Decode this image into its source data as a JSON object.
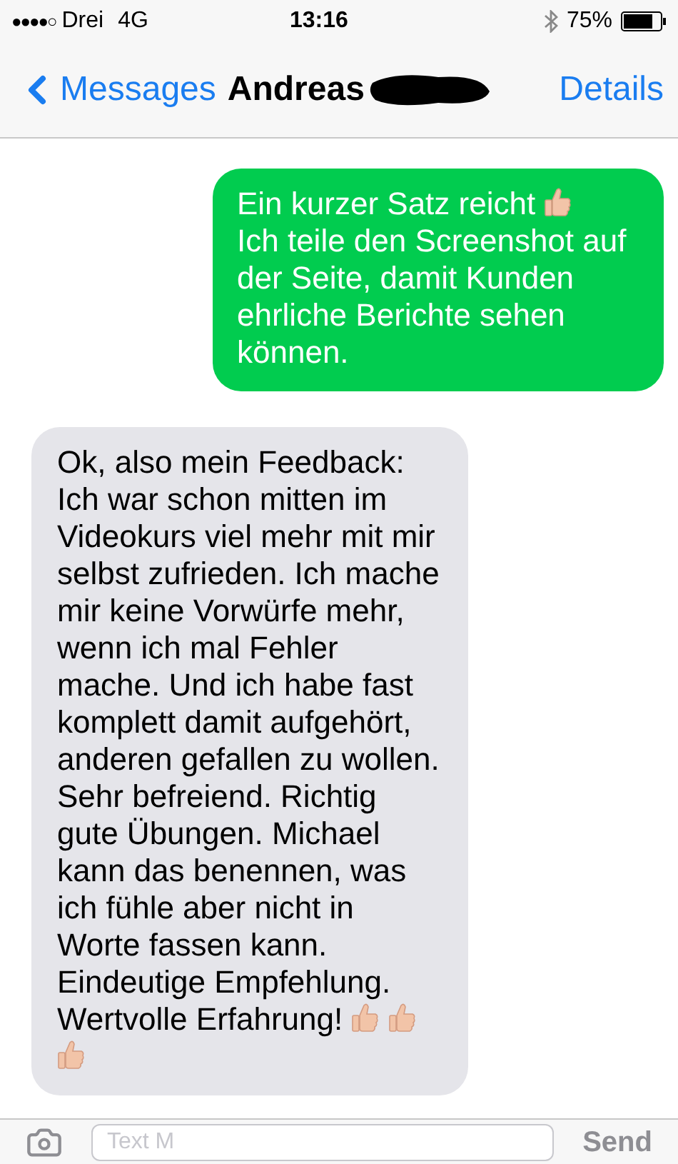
{
  "status_bar": {
    "signal": "●●●●○",
    "carrier": "Drei",
    "network": "4G",
    "time": "13:16",
    "battery": "75%"
  },
  "nav": {
    "back": "Messages",
    "contact": "Andreas",
    "details": "Details"
  },
  "messages": [
    {
      "kind": "sent",
      "parts": [
        {
          "kind": "text",
          "text": "Ein kurzer Satz reicht "
        },
        {
          "kind": "thumbs"
        },
        {
          "kind": "break"
        },
        {
          "kind": "text",
          "text": "Ich teile den Screenshot auf der Seite, damit Kunden ehrliche Berichte sehen können."
        }
      ]
    },
    {
      "kind": "received",
      "parts": [
        {
          "kind": "text",
          "text": "Ok, also mein Feedback: Ich war schon mitten im Videokurs viel mehr mit mir selbst zufrieden. Ich mache mir keine Vorwürfe mehr, wenn ich mal Fehler mache. Und ich habe fast komplett damit aufgehört, anderen gefallen zu wollen. Sehr befreiend. Richtig gute Übungen. Michael kann das benennen, was ich fühle aber nicht in Worte fassen kann. Eindeutige Empfehlung. Wertvolle Erfahrung! "
        },
        {
          "kind": "thumbs"
        },
        {
          "kind": "thumbs"
        },
        {
          "kind": "thumbs"
        }
      ]
    }
  ],
  "compose": {
    "placeholder": "Text M",
    "send": "Send"
  }
}
